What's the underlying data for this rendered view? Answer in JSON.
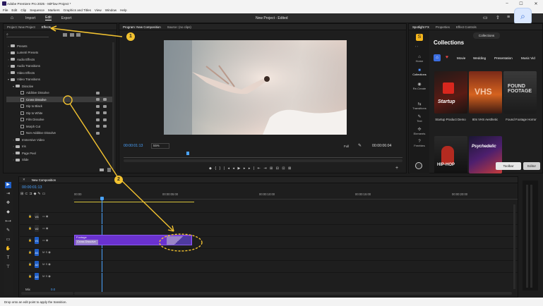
{
  "window": {
    "title": "Adobe Premiere Pro 2025 - MiFlow Project *",
    "controls": [
      "–",
      "☐",
      "✕"
    ]
  },
  "menu": [
    "File",
    "Edit",
    "Clip",
    "Sequence",
    "Markers",
    "Graphics and Titles",
    "View",
    "Window",
    "Help"
  ],
  "header": {
    "nav": [
      "Import",
      "Edit",
      "Export"
    ],
    "active": "Edit",
    "project_title": "New Project - Edited"
  },
  "project_panel": {
    "tabs": [
      "Project: New Project",
      "Effects"
    ],
    "active_tab": "Effects",
    "tree": [
      {
        "label": "Presets",
        "level": 0,
        "kind": "folder",
        "open": false
      },
      {
        "label": "Lumetri Presets",
        "level": 0,
        "kind": "folder",
        "open": false
      },
      {
        "label": "Audio Effects",
        "level": 0,
        "kind": "folder",
        "open": false
      },
      {
        "label": "Audio Transitions",
        "level": 0,
        "kind": "folder",
        "open": false
      },
      {
        "label": "Video Effects",
        "level": 0,
        "kind": "folder",
        "open": false
      },
      {
        "label": "Video Transitions",
        "level": 0,
        "kind": "folder",
        "open": true
      },
      {
        "label": "Dissolve",
        "level": 1,
        "kind": "folder",
        "open": true
      },
      {
        "label": "Additive Dissolve",
        "level": 2,
        "kind": "fx"
      },
      {
        "label": "Cross Dissolve",
        "level": 2,
        "kind": "fx",
        "selected": true
      },
      {
        "label": "Dip to Black",
        "level": 2,
        "kind": "fx"
      },
      {
        "label": "Dip to White",
        "level": 2,
        "kind": "fx"
      },
      {
        "label": "Film Dissolve",
        "level": 2,
        "kind": "fx"
      },
      {
        "label": "Morph Cut",
        "level": 2,
        "kind": "fx"
      },
      {
        "label": "Non-Additive Dissolve",
        "level": 2,
        "kind": "fx"
      },
      {
        "label": "Immersive Video",
        "level": 1,
        "kind": "folder",
        "open": false
      },
      {
        "label": "Iris",
        "level": 1,
        "kind": "folder",
        "open": false
      },
      {
        "label": "Page Peel",
        "level": 1,
        "kind": "folder",
        "open": false
      },
      {
        "label": "Slide",
        "level": 1,
        "kind": "folder",
        "open": false
      }
    ]
  },
  "program_monitor": {
    "tabs": [
      "Program: New Composition",
      "Source: (no clips)"
    ],
    "timecode_left": "00:00:01:13",
    "zoom": "55%",
    "quality": "Full",
    "timecode_right": "00:00:06:04"
  },
  "spotlight": {
    "tabs": [
      "Spotlight FX",
      "Properties",
      "Effect Controls"
    ],
    "heading": "Collections",
    "collections_btn": "Collections",
    "chips": [
      "Movie",
      "Wedding",
      "Presentation",
      "Music Vid"
    ],
    "side_nav": [
      "Home",
      "Collections",
      "Re-Create",
      "Transitions",
      "Text",
      "Elements",
      "Freebies"
    ],
    "cards": [
      {
        "title_art": "Startup",
        "label": "Startup Product Demo"
      },
      {
        "title_art": "VHS",
        "label": "80s VHS Aesthetic"
      },
      {
        "title_art": "FOUND FOOTAGE",
        "label": "Found Footage Horror"
      },
      {
        "title_art": "HIP-HOP",
        "label": ""
      },
      {
        "title_art": "Psychedelic",
        "label": ""
      }
    ],
    "toolbar_btn": "Toolbar",
    "editor_btn": "Editor"
  },
  "timeline": {
    "tab": "New Composition",
    "timecode": "00:00:01:13",
    "ruler": [
      "00:00",
      "00:00:05:00",
      "00:00:10:00",
      "00:00:15:00",
      "00:00:20:00"
    ],
    "tracks": [
      {
        "name": "V3",
        "type": "video"
      },
      {
        "name": "V2",
        "type": "video"
      },
      {
        "name": "V1",
        "type": "video"
      },
      {
        "name": "A1",
        "type": "audio"
      },
      {
        "name": "A2",
        "type": "audio"
      },
      {
        "name": "A3",
        "type": "audio"
      }
    ],
    "mix": "Mix",
    "mix_value": "0.0",
    "clip_name": "Footage",
    "transition_name": "Cross Dissolve"
  },
  "annotations": {
    "step1": "1",
    "step2": "2",
    "color": "#f2c230"
  },
  "status": "Drop onto an edit point to apply the transition."
}
